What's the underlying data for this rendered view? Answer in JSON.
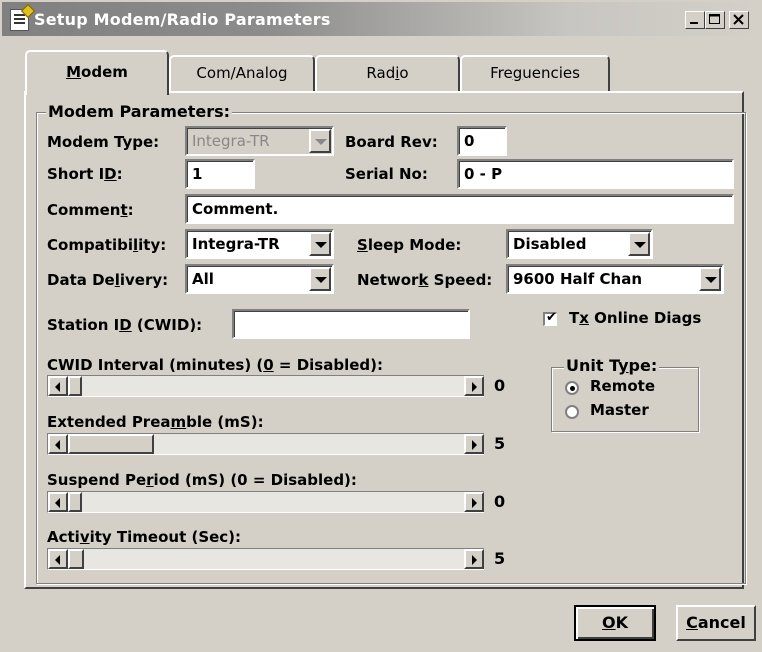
{
  "window": {
    "title": "Setup Modem/Radio Parameters",
    "controls": [
      "minimize-icon",
      "maximize-icon",
      "close-icon"
    ],
    "title_color": "#ffffff"
  },
  "tabs": [
    {
      "label": "Modem",
      "active": true
    },
    {
      "label": "Com/Analog",
      "active": false
    },
    {
      "label": "Radio",
      "active": false
    },
    {
      "label": "Freguencies",
      "active": false
    }
  ],
  "modem_params": {
    "group_label": "Modem Parameters:",
    "modem_type": {
      "label": "Modem Type:",
      "value": "Integra-TR",
      "enabled": false
    },
    "board_rev": {
      "label": "Board Rev:",
      "value": "0"
    },
    "short_id": {
      "label": "Short ID:",
      "value": "1"
    },
    "serial_no": {
      "label": "Serial No:",
      "value": "0 - P"
    },
    "comment": {
      "label": "Comment:",
      "value": "Comment."
    },
    "compatibility": {
      "label": "Compatibility:",
      "value": "Integra-TR"
    },
    "sleep_mode": {
      "label": "Sleep Mode:",
      "value": "Disabled"
    },
    "data_delivery": {
      "label": "Data Delivery:",
      "value": "All"
    },
    "network_speed": {
      "label": "Network Speed:",
      "value": "9600 Half Chan"
    },
    "station_id": {
      "label": "Station ID (CWID):",
      "value": ""
    },
    "tx_online_diags": {
      "label": "Tx Online Diags",
      "checked": true
    }
  },
  "sliders": [
    {
      "label": "CWID Interval (minutes) (0 = Disabled):",
      "value": "0"
    },
    {
      "label": "Extended Preamble (mS):",
      "value": "5"
    },
    {
      "label": "Suspend Period (mS) (0 = Disabled):",
      "value": "0"
    },
    {
      "label": "Activity Timeout (Sec):",
      "value": "5"
    }
  ],
  "unit_type": {
    "label": "Unit Type:",
    "options": [
      {
        "label": "Remote",
        "selected": true
      },
      {
        "label": "Master",
        "selected": false
      }
    ]
  },
  "buttons": {
    "ok": "OK",
    "cancel": "Cancel"
  }
}
